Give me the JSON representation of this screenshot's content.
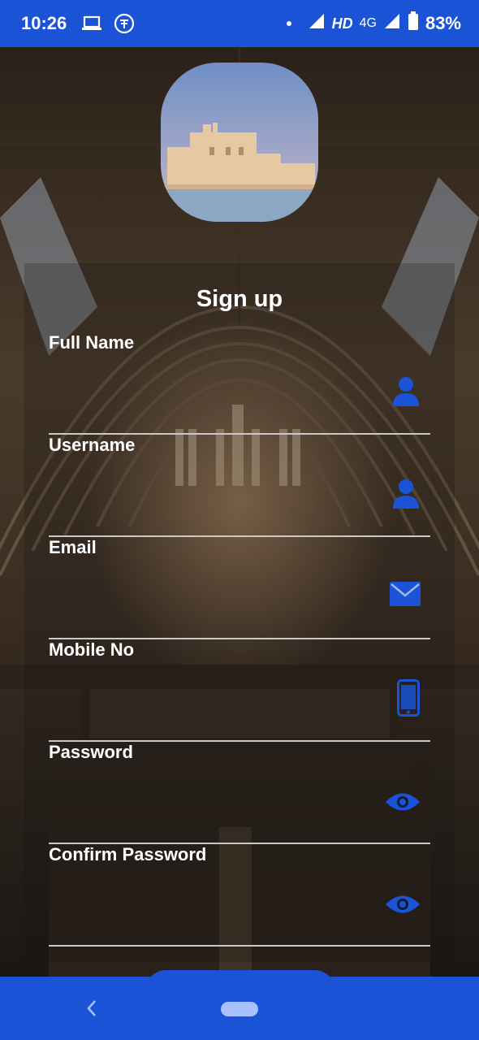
{
  "status_bar": {
    "time": "10:26",
    "hd": "HD",
    "network": "4G",
    "battery": "83%"
  },
  "form": {
    "title": "Sign up",
    "fields": [
      {
        "label": "Full Name",
        "icon": "person-icon"
      },
      {
        "label": "Username",
        "icon": "person-icon"
      },
      {
        "label": "Email",
        "icon": "envelope-icon"
      },
      {
        "label": "Mobile No",
        "icon": "mobile-phone-icon"
      },
      {
        "label": "Password",
        "icon": "eye-icon"
      },
      {
        "label": "Confirm Password",
        "icon": "eye-icon"
      }
    ]
  },
  "colors": {
    "accent": "#1a53d6",
    "icon": "#1a53d6",
    "underline": "#c9c9c9"
  }
}
